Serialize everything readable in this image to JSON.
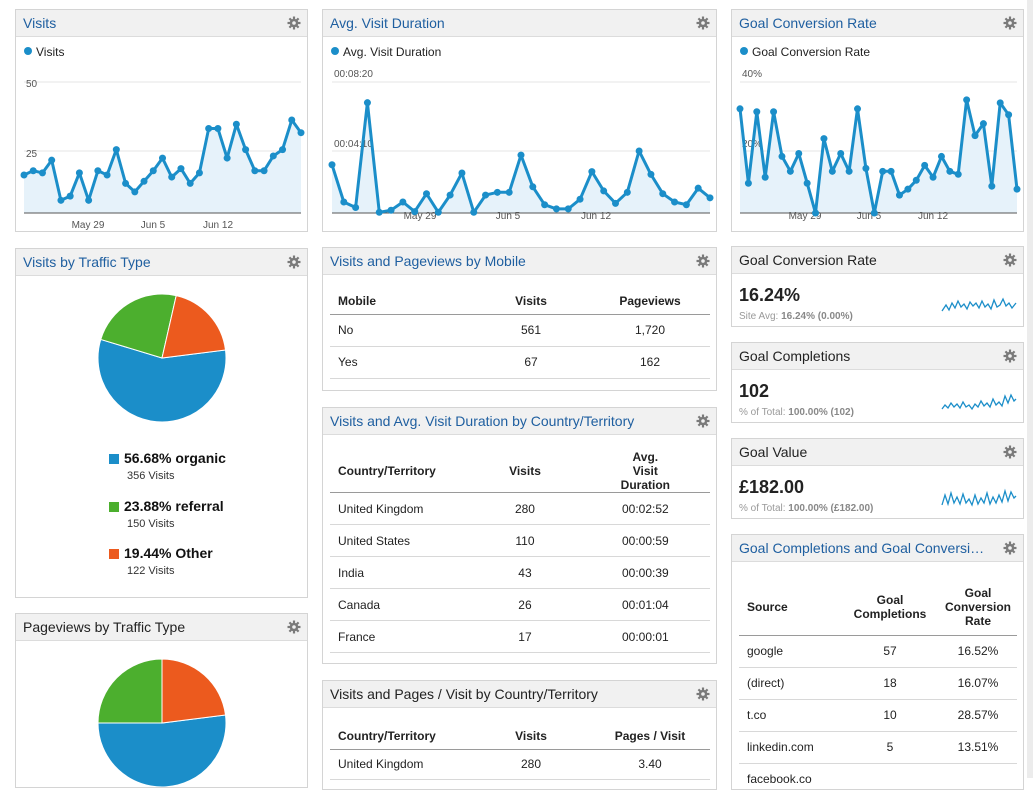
{
  "icons": {
    "gear": "gear-icon"
  },
  "colors": {
    "accent": "#1b8ec9",
    "organic": "#1b8ec9",
    "referral": "#4caf2e",
    "other": "#ec5a1e"
  },
  "visits_widget": {
    "title": "Visits",
    "legend": "Visits",
    "y_ticks": [
      "50",
      "25"
    ],
    "x_ticks": [
      "May 29",
      "Jun 5",
      "Jun 12"
    ]
  },
  "avg_duration_widget": {
    "title": "Avg. Visit Duration",
    "legend": "Avg. Visit Duration",
    "y_ticks": [
      "00:08:20",
      "00:04:10"
    ],
    "x_ticks": [
      "May 29",
      "Jun 5",
      "Jun 12"
    ]
  },
  "goal_rate_widget": {
    "title": "Goal Conversion Rate",
    "legend": "Goal Conversion Rate",
    "y_ticks": [
      "40%",
      "20%"
    ],
    "x_ticks": [
      "May 29",
      "Jun 5",
      "Jun 12"
    ]
  },
  "traffic_visits": {
    "title": "Visits by Traffic Type",
    "slices": [
      {
        "pct": "56.68% organic",
        "sub": "356 Visits",
        "fraction": 0.5668,
        "color": "#1b8ec9"
      },
      {
        "pct": "23.88% referral",
        "sub": "150 Visits",
        "fraction": 0.2388,
        "color": "#4caf2e"
      },
      {
        "pct": "19.44% Other",
        "sub": "122 Visits",
        "fraction": 0.1944,
        "color": "#ec5a1e"
      }
    ]
  },
  "traffic_pageviews": {
    "title": "Pageviews by Traffic Type",
    "slices": [
      {
        "fraction": 0.52,
        "color": "#1b8ec9"
      },
      {
        "fraction": 0.25,
        "color": "#4caf2e"
      },
      {
        "fraction": 0.23,
        "color": "#ec5a1e"
      }
    ]
  },
  "mobile_table": {
    "title": "Visits and Pageviews by Mobile",
    "headers": [
      "Mobile",
      "Visits",
      "Pageviews"
    ],
    "rows": [
      [
        "No",
        "561",
        "1,720"
      ],
      [
        "Yes",
        "67",
        "162"
      ]
    ]
  },
  "country_duration_table": {
    "title": "Visits and Avg. Visit Duration by Country/Territory",
    "headers": [
      "Country/Territory",
      "Visits",
      "Avg. Visit Duration"
    ],
    "rows": [
      [
        "United Kingdom",
        "280",
        "00:02:52"
      ],
      [
        "United States",
        "110",
        "00:00:59"
      ],
      [
        "India",
        "43",
        "00:00:39"
      ],
      [
        "Canada",
        "26",
        "00:01:04"
      ],
      [
        "France",
        "17",
        "00:00:01"
      ]
    ]
  },
  "country_pages_table": {
    "title": "Visits and Pages / Visit by Country/Territory",
    "headers": [
      "Country/Territory",
      "Visits",
      "Pages / Visit"
    ],
    "rows": [
      [
        "United Kingdom",
        "280",
        "3.40"
      ]
    ]
  },
  "kpi_rate": {
    "title": "Goal Conversion Rate",
    "value": "16.24%",
    "sub_label": "Site Avg:",
    "sub_value": "16.24% (0.00%)"
  },
  "kpi_completions": {
    "title": "Goal Completions",
    "value": "102",
    "sub_label": "% of Total:",
    "sub_value": "100.00% (102)"
  },
  "kpi_value": {
    "title": "Goal Value",
    "value": "£182.00",
    "sub_label": "% of Total:",
    "sub_value": "100.00% (£182.00)"
  },
  "source_table": {
    "title": "Goal Completions and Goal Conversi…",
    "headers": [
      "Source",
      "Goal Completions",
      "Goal Conversion Rate"
    ],
    "rows": [
      [
        "google",
        "57",
        "16.52%"
      ],
      [
        "(direct)",
        "18",
        "16.07%"
      ],
      [
        "t.co",
        "10",
        "28.57%"
      ],
      [
        "linkedin.com",
        "5",
        "13.51%"
      ],
      [
        "facebook.co",
        "",
        ""
      ]
    ]
  },
  "chart_data": [
    {
      "type": "line",
      "name": "Visits",
      "ylim": [
        0,
        62
      ],
      "values": [
        18,
        20,
        19,
        25,
        6,
        8,
        19,
        6,
        20,
        18,
        30,
        14,
        10,
        15,
        20,
        26,
        17,
        21,
        14,
        19,
        40,
        40,
        26,
        42,
        30,
        20,
        20,
        27,
        30,
        44,
        38
      ]
    },
    {
      "type": "line",
      "name": "Avg. Visit Duration",
      "ylim": [
        0,
        9.5
      ],
      "values": [
        3.5,
        0.8,
        0.4,
        8.0,
        0.05,
        0.2,
        0.8,
        0.1,
        1.4,
        0.05,
        1.3,
        2.9,
        0.05,
        1.3,
        1.5,
        1.5,
        4.2,
        1.9,
        0.6,
        0.3,
        0.3,
        1.0,
        3.0,
        1.6,
        0.7,
        1.5,
        4.5,
        2.8,
        1.4,
        0.8,
        0.6,
        1.8,
        1.1
      ]
    },
    {
      "type": "line",
      "name": "Goal Conversion Rate",
      "ylim": [
        0,
        44
      ],
      "values": [
        35,
        10,
        34,
        12,
        34,
        19,
        14,
        20,
        10,
        0,
        25,
        14,
        20,
        14,
        35,
        15,
        0,
        14,
        14,
        6,
        8,
        11,
        16,
        12,
        19,
        14,
        13,
        38,
        26,
        30,
        9,
        37,
        33,
        8
      ]
    }
  ]
}
